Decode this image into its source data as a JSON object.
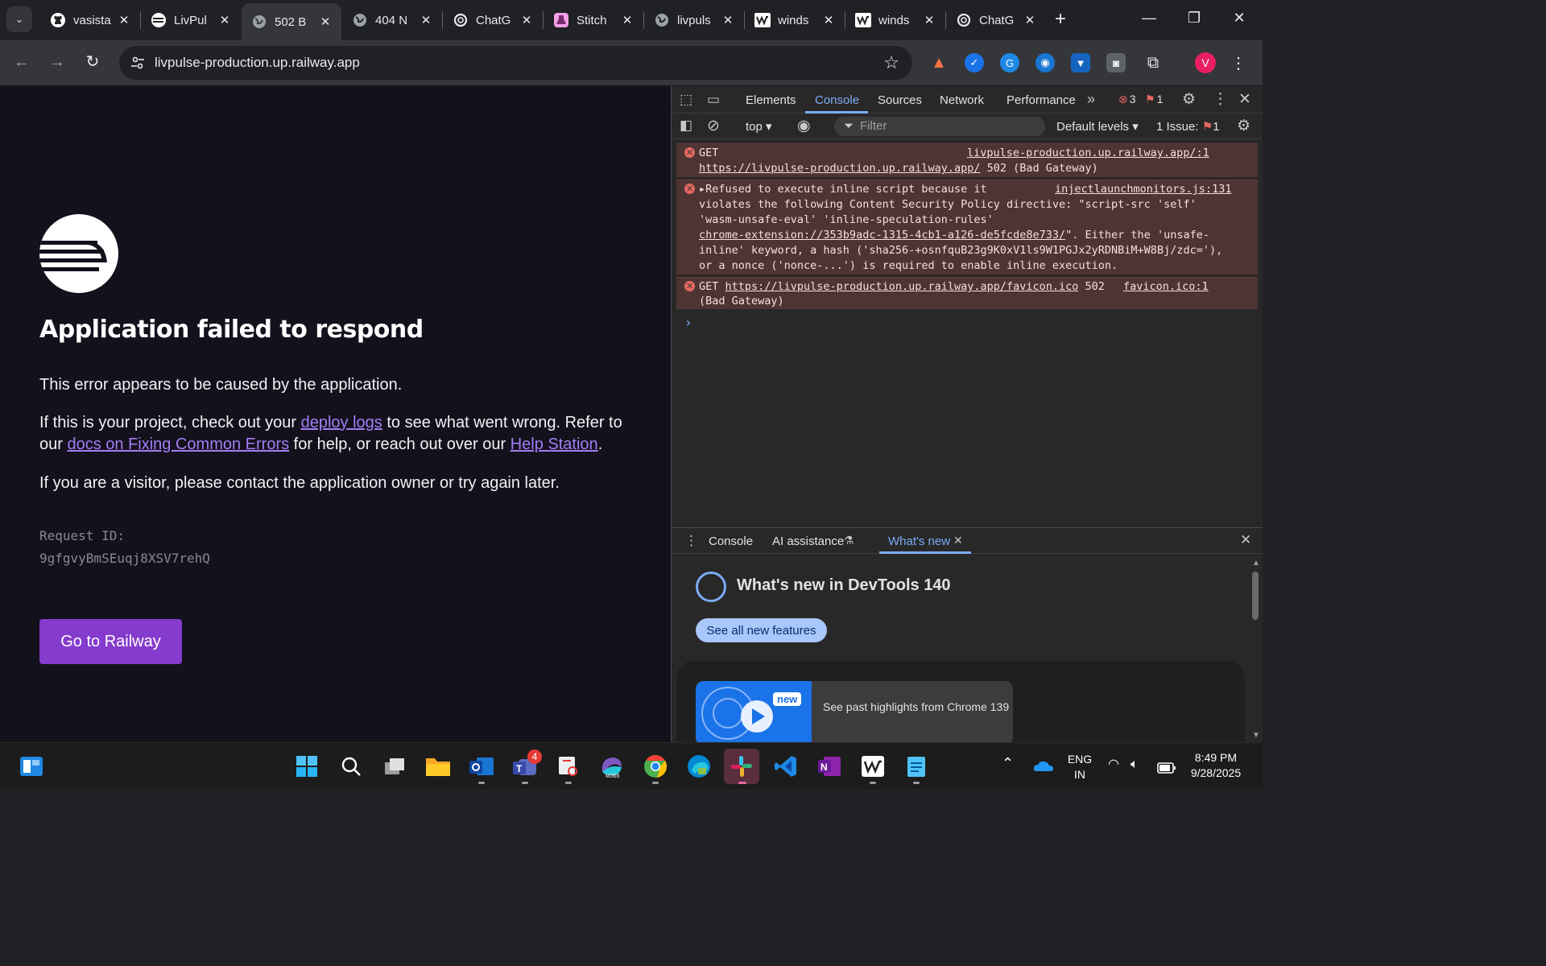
{
  "browser": {
    "tabs": [
      {
        "title": "vasista",
        "icon": "github-icon",
        "active": false
      },
      {
        "title": "LivPul",
        "icon": "livpulse-icon",
        "active": false
      },
      {
        "title": "502 B",
        "icon": "globe-icon",
        "active": true
      },
      {
        "title": "404 N",
        "icon": "globe-icon",
        "active": false
      },
      {
        "title": "ChatG",
        "icon": "chatgpt-icon",
        "active": false
      },
      {
        "title": "Stitch",
        "icon": "stitch-icon",
        "active": false
      },
      {
        "title": "livpuls",
        "icon": "globe-icon",
        "active": false
      },
      {
        "title": "winds",
        "icon": "windsurf-icon",
        "active": false
      },
      {
        "title": "winds",
        "icon": "windsurf-icon",
        "active": false
      },
      {
        "title": "ChatG",
        "icon": "chatgpt-icon",
        "active": false
      }
    ],
    "url": "livpulse-production.up.railway.app",
    "profile_initial": "V"
  },
  "page": {
    "heading": "Application failed to respond",
    "para1": "This error appears to be caused by the application.",
    "para2": {
      "t1": "If this is your project, check out your ",
      "link1": "deploy logs",
      "t2": " to see what went wrong. Refer to our ",
      "link2": "docs on Fixing Common Errors",
      "t3": " for help, or reach out over our ",
      "link3": "Help Station",
      "t4": "."
    },
    "para3": "If you are a visitor, please contact the application owner or try again later.",
    "request_label": "Request ID:",
    "request_id": "9gfgvyBmSEuqj8XSV7rehQ",
    "button": "Go to Railway"
  },
  "devtools": {
    "tabs": [
      "Elements",
      "Console",
      "Sources",
      "Network",
      "Performance"
    ],
    "active_tab": "Console",
    "error_count": "3",
    "issue_badge": "1",
    "context": "top",
    "filter_placeholder": "Filter",
    "levels": "Default levels",
    "issues_label": "1 Issue:",
    "issues_count": "1",
    "messages": {
      "m1_line1": "GET",
      "m1_source": "livpulse-production.up.railway.app/:1",
      "m1_url": "https://livpulse-production.up.railway.app/",
      "m1_status": " 502 (Bad Gateway)",
      "m2_l1": "Refused to execute inline script because it",
      "m2_source": "injectlaunchmonitors.js:131",
      "m2_l2": "violates the following Content Security Policy directive: \"script-src 'self'",
      "m2_l3": "'wasm-unsafe-eval' 'inline-speculation-rules'",
      "m2_l4_link": "chrome-extension://353b9adc-1315-4cb1-a126-de5fcde8e733/",
      "m2_l4_rest": "\". Either the 'unsafe-",
      "m2_l5": "inline' keyword, a hash ('sha256-+osnfquB23g9K0xV1ls9W1PGJx2yRDNBiM+W8Bj/zdc='),",
      "m2_l6": "or a nonce ('nonce-...') is required to enable inline execution.",
      "m3_get": "GET ",
      "m3_url": "https://livpulse-production.up.railway.app/favicon.ico",
      "m3_status": " 502",
      "m3_source": "favicon.ico:1",
      "m3_line2": "(Bad Gateway)"
    },
    "drawer": {
      "tabs": [
        "Console",
        "AI assistance",
        "What's new"
      ],
      "active": "What's new",
      "title": "What's new in DevTools 140",
      "button": "See all new features",
      "badge": "new",
      "caption": "See past highlights from Chrome 139"
    }
  },
  "taskbar": {
    "teams_badge": "4",
    "lang1": "ENG",
    "lang2": "IN",
    "time": "8:49 PM",
    "date": "9/28/2025"
  }
}
